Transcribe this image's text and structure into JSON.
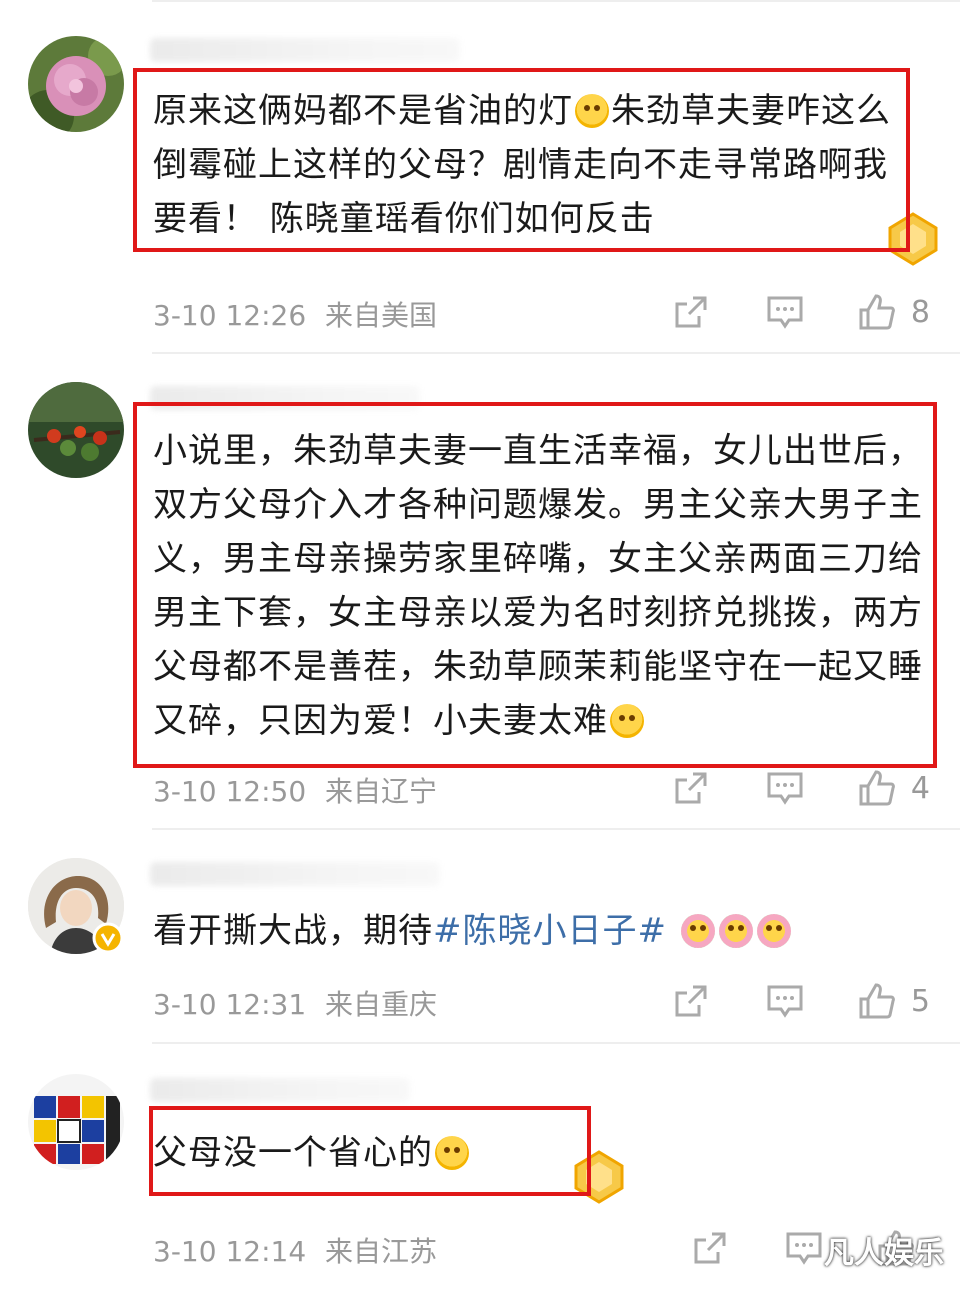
{
  "comments": [
    {
      "text_parts": [
        "原来这俩妈都不是省油的灯",
        "朱劲草夫妻咋这么倒霉碰上这样的父母？剧情走向不走寻常路啊我要看！ 陈晓童瑶看你们如何反击"
      ],
      "emoji": "crying-face-emoji",
      "time": "3-10 12:26",
      "location": "来自美国",
      "likes": "8"
    },
    {
      "text": "小说里，朱劲草夫妻一直生活幸福，女儿出世后，双方父母介入才各种问题爆发。男主父亲大男子主义，男主母亲操劳家里碎嘴，女主父亲两面三刀给男主下套，女主母亲以爱为名时刻挤兑挑拨，两方父母都不是善茬，朱劲草顾茉莉能坚守在一起又睡又碎，只因为爱！小夫妻太难",
      "emoji": "laughing-tears-emoji",
      "time": "3-10 12:50",
      "location": "来自辽宁",
      "likes": "4"
    },
    {
      "text_prefix": "看开撕大战，期待",
      "hashtag": "#陈晓小日子#",
      "emoji": "flower-face-emoji",
      "time": "3-10 12:31",
      "location": "来自重庆",
      "likes": "5"
    },
    {
      "text": "父母没一个省心的",
      "emoji": "laughing-tears-emoji",
      "time": "3-10 12:14",
      "location": "来自江苏",
      "likes": ""
    }
  ],
  "watermark": "凡人娱乐",
  "colors": {
    "highlight_border": "#e01818",
    "hashtag": "#3d6ea8",
    "meta_text": "#999999"
  },
  "icons": [
    "share-icon",
    "comment-icon",
    "like-icon"
  ]
}
